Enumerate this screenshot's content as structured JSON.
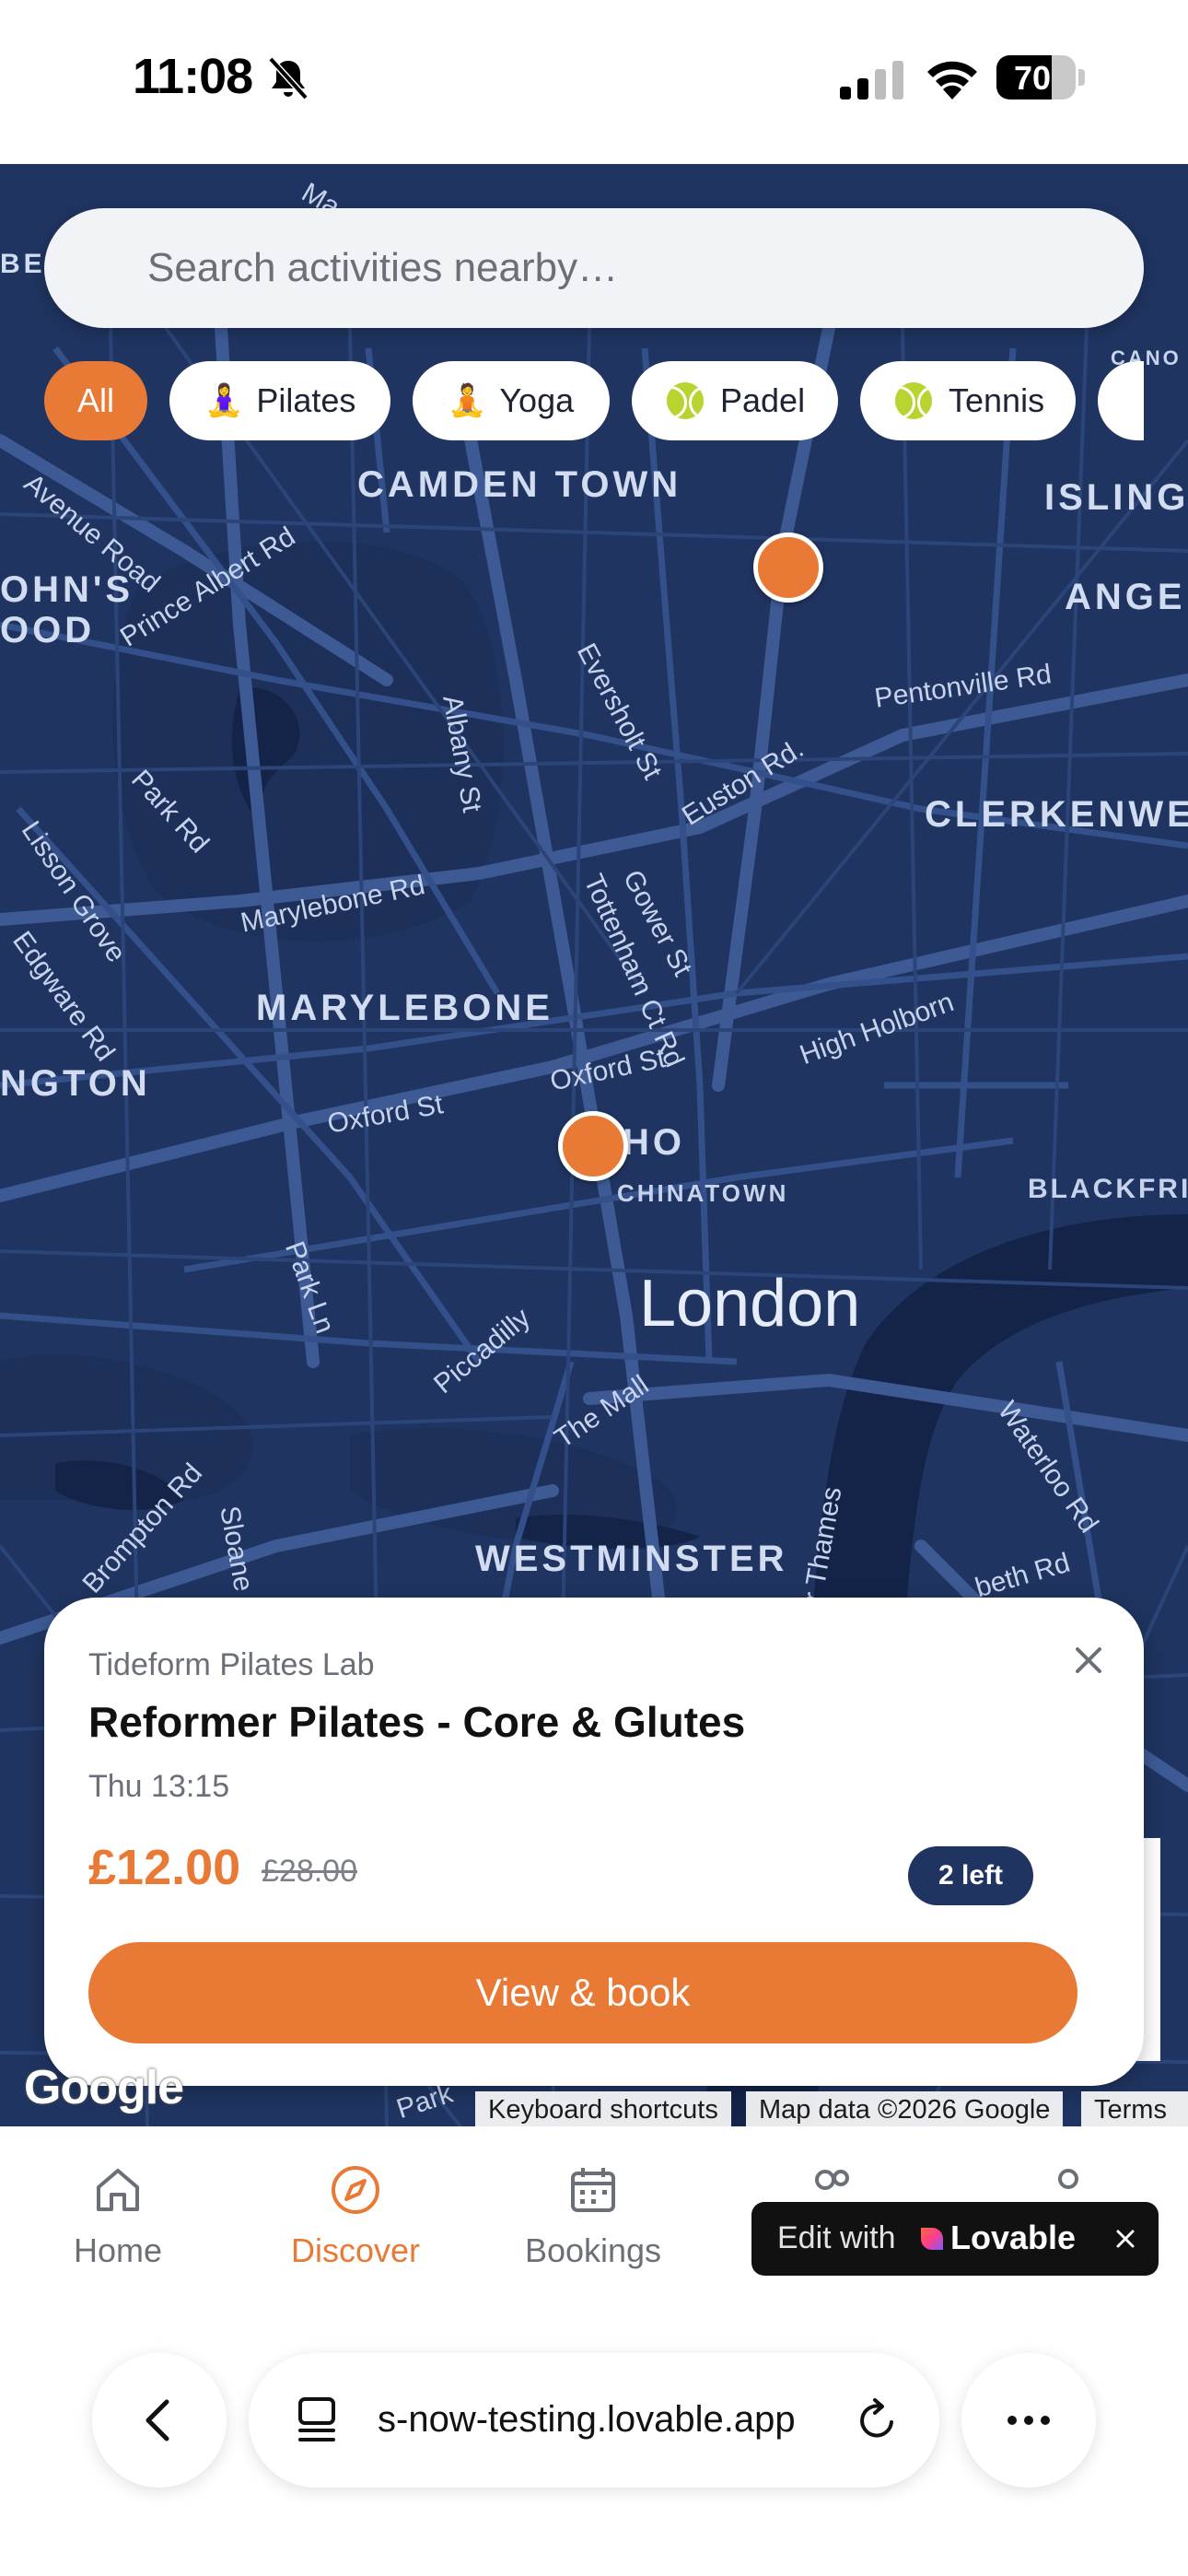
{
  "status_bar": {
    "time": "11:08",
    "battery": "70",
    "battery_level": 0.7
  },
  "search": {
    "placeholder": "Search activities nearby…"
  },
  "filters": [
    {
      "label": "All",
      "icon": "",
      "active": true
    },
    {
      "label": "Pilates",
      "icon": "person-lotus-emoji",
      "active": false
    },
    {
      "label": "Yoga",
      "icon": "person-lotus-emoji",
      "active": false
    },
    {
      "label": "Padel",
      "icon": "tennis-ball-icon",
      "active": false
    },
    {
      "label": "Tennis",
      "icon": "tennis-ball-icon",
      "active": false
    }
  ],
  "map": {
    "labels": {
      "camden_town": "CAMDEN TOWN",
      "islington": "ISLING",
      "angel": "ANGE",
      "johns_wood_1": "OHN'S",
      "johns_wood_2": "OOD",
      "clerkenwell": "CLERKENWE",
      "marylebone": "MARYLEBONE",
      "paddington": "NGTON",
      "soho": "HO",
      "chinatown": "CHINATOWN",
      "blackfriars": "BLACKFRI",
      "london": "London",
      "westminster": "WESTMINSTER",
      "belsize": "BE",
      "canonbury": "CANO",
      "road_avenue": "Avenue Road",
      "road_prince_albert": "Prince Albert Rd",
      "road_albany": "Albany St",
      "road_eversholt": "Eversholt St",
      "road_euston": "Euston Rd.",
      "road_pentonville": "Pentonville Rd",
      "road_park": "Park Rd",
      "road_lisson": "Lisson Grove",
      "road_marylebone": "Marylebone Rd",
      "road_gower": "Gower St",
      "road_tottenham": "Tottenham Ct Rd",
      "road_edgware": "Edgware Rd",
      "road_high_holborn": "High Holborn",
      "road_oxford_1": "Oxford St",
      "road_oxford_2": "Oxford St",
      "road_park_ln": "Park Ln",
      "road_piccadilly": "Piccadilly",
      "road_the_mall": "The Mall",
      "road_waterloo": "Waterloo Rd",
      "road_brompton": "Brompton Rd",
      "road_sloane": "Sloane S",
      "road_thames": "er Thames",
      "road_beth": "beth Rd",
      "road_mai": "Ma",
      "road_park_bottom": "Park"
    },
    "attribution": {
      "logo": "Google",
      "keyboard": "Keyboard shortcuts",
      "data": "Map data ©2026 Google",
      "terms": "Terms"
    }
  },
  "card": {
    "studio": "Tideform Pilates Lab",
    "title": "Reformer Pilates - Core & Glutes",
    "time": "Thu 13:15",
    "price": "£12.00",
    "old_price": "£28.00",
    "badge": "2 left",
    "button": "View & book"
  },
  "nav": {
    "home": "Home",
    "discover": "Discover",
    "bookings": "Bookings"
  },
  "lovable": {
    "edit": "Edit with",
    "brand": "Lovable"
  },
  "browser": {
    "url": "s-now-testing.lovable.app"
  },
  "colors": {
    "accent": "#e87a35",
    "map_base": "#1f3460",
    "badge": "#1f3460"
  }
}
